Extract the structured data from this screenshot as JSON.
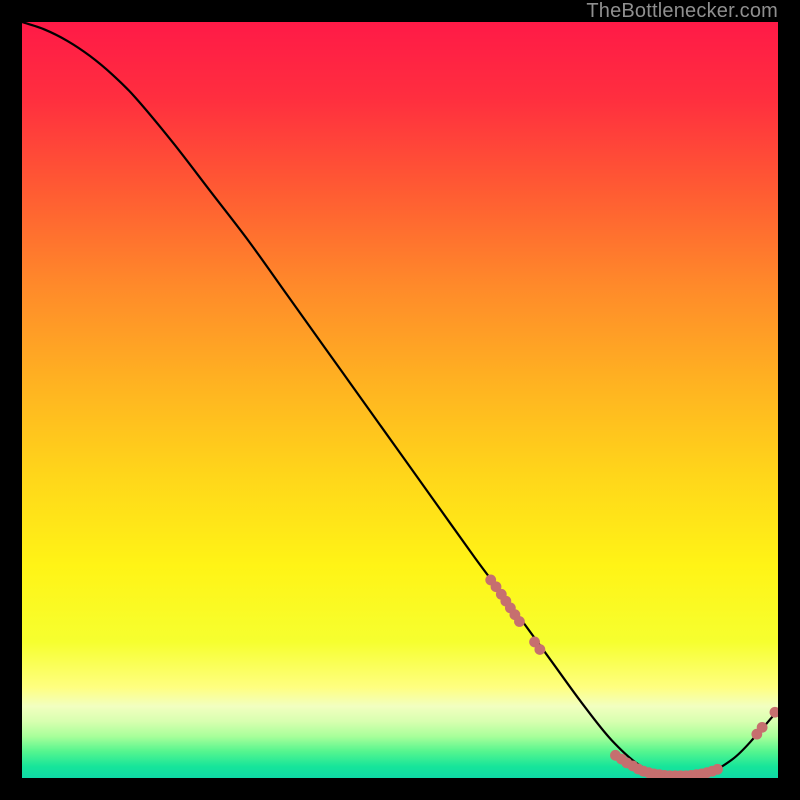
{
  "attribution": "TheBottlenecker.com",
  "chart_data": {
    "type": "line",
    "title": "",
    "xlabel": "",
    "ylabel": "",
    "xlim": [
      0,
      100
    ],
    "ylim": [
      0,
      100
    ],
    "series": [
      {
        "name": "curve",
        "x": [
          0,
          3,
          6,
          9,
          12,
          15,
          20,
          25,
          30,
          35,
          40,
          45,
          50,
          55,
          60,
          63,
          66,
          70,
          74,
          78,
          82,
          86,
          90,
          94,
          97,
          100
        ],
        "y": [
          100,
          99,
          97.5,
          95.5,
          93,
          90,
          84,
          77.5,
          71,
          64,
          57,
          50,
          43,
          36,
          29,
          25,
          21,
          15.5,
          10,
          5,
          1.5,
          0.3,
          0.3,
          2.5,
          5.5,
          9
        ]
      }
    ],
    "markers": [
      {
        "series": "cluster-a",
        "color": "#c66f6f",
        "r": 5.4,
        "points": [
          {
            "x": 62.0,
            "y": 26.2
          },
          {
            "x": 62.7,
            "y": 25.3
          },
          {
            "x": 63.4,
            "y": 24.3
          },
          {
            "x": 64.0,
            "y": 23.4
          },
          {
            "x": 64.6,
            "y": 22.5
          },
          {
            "x": 65.2,
            "y": 21.6
          },
          {
            "x": 65.8,
            "y": 20.7
          },
          {
            "x": 67.8,
            "y": 18.0
          },
          {
            "x": 68.5,
            "y": 17.0
          }
        ]
      },
      {
        "series": "cluster-b",
        "color": "#c66f6f",
        "r": 5.4,
        "points": [
          {
            "x": 78.5,
            "y": 3.0
          },
          {
            "x": 79.3,
            "y": 2.5
          },
          {
            "x": 80.0,
            "y": 2.0
          },
          {
            "x": 80.8,
            "y": 1.6
          },
          {
            "x": 81.5,
            "y": 1.2
          },
          {
            "x": 82.2,
            "y": 0.9
          },
          {
            "x": 82.9,
            "y": 0.7
          },
          {
            "x": 83.6,
            "y": 0.55
          },
          {
            "x": 84.3,
            "y": 0.45
          },
          {
            "x": 85.0,
            "y": 0.35
          },
          {
            "x": 85.7,
            "y": 0.3
          },
          {
            "x": 86.4,
            "y": 0.3
          },
          {
            "x": 87.1,
            "y": 0.3
          },
          {
            "x": 87.8,
            "y": 0.3
          },
          {
            "x": 88.5,
            "y": 0.35
          },
          {
            "x": 89.2,
            "y": 0.45
          },
          {
            "x": 89.9,
            "y": 0.55
          },
          {
            "x": 90.6,
            "y": 0.7
          },
          {
            "x": 91.3,
            "y": 0.9
          },
          {
            "x": 92.0,
            "y": 1.15
          }
        ]
      },
      {
        "series": "cluster-c",
        "color": "#c66f6f",
        "r": 5.4,
        "points": [
          {
            "x": 97.2,
            "y": 5.8
          },
          {
            "x": 97.9,
            "y": 6.7
          },
          {
            "x": 99.6,
            "y": 8.7
          }
        ]
      }
    ],
    "gradient_stops": [
      {
        "t": 0.0,
        "c": "#ff1a47"
      },
      {
        "t": 0.1,
        "c": "#ff2e3f"
      },
      {
        "t": 0.22,
        "c": "#ff5a33"
      },
      {
        "t": 0.35,
        "c": "#ff8a2a"
      },
      {
        "t": 0.48,
        "c": "#ffb321"
      },
      {
        "t": 0.6,
        "c": "#ffd61a"
      },
      {
        "t": 0.72,
        "c": "#fff416"
      },
      {
        "t": 0.82,
        "c": "#f6ff2f"
      },
      {
        "t": 0.88,
        "c": "#ffff80"
      },
      {
        "t": 0.905,
        "c": "#f2ffc0"
      },
      {
        "t": 0.925,
        "c": "#d8ffb0"
      },
      {
        "t": 0.945,
        "c": "#a8ff9a"
      },
      {
        "t": 0.965,
        "c": "#55f58f"
      },
      {
        "t": 0.985,
        "c": "#16e59a"
      },
      {
        "t": 1.0,
        "c": "#0fd9a6"
      }
    ]
  }
}
